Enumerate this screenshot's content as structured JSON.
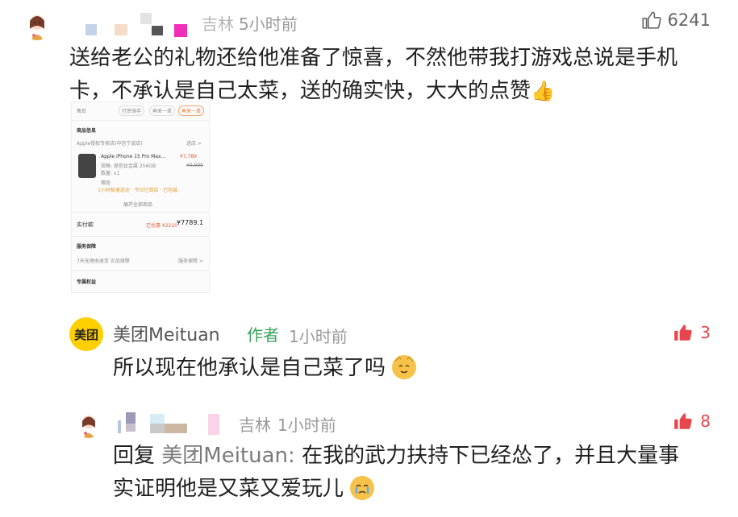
{
  "top_comment": {
    "author": "吉林",
    "time": "5小时前",
    "likes": "6241",
    "text_line1": "送给老公的礼物还给他准备了惊喜，不然他带我打游戏总说是手机",
    "text_line2": "卡，不承认是自己太菜，送的确实快，大大的点赞",
    "thumb_emoji": "👍"
  },
  "order_screenshot": {
    "tab_after_sale": "售后",
    "tab_support": "打赏骑手",
    "tab_resend": "再来一单",
    "tab_again": "再来一单",
    "section_goods": "商品信息",
    "store_name": "Apple授权专卖店(中信宁波店)",
    "store_link": "进店 >",
    "product_name": "Apple iPhone 15 Pro Max...",
    "product_spec": "规格: 原色钛金属 256GB",
    "product_qty": "数量: x1",
    "product_price": "¥7,789",
    "product_orig_price": "¥9,999",
    "gift_label": "赠品",
    "promo_text": "1小时极速送达 · 今日已到店 · 已包装",
    "expand_text": "展开全部商品",
    "paid_label": "实付款",
    "paid_note": "已优惠 ¥2210",
    "paid_amount": "¥7789.1",
    "section_service": "服务保障",
    "service_text": "7天无理由退货  正品保障",
    "service_link": "服务保障 >",
    "section_delivery": "专属权益"
  },
  "reply_meituan": {
    "author": "美团Meituan",
    "badge": "作者",
    "time": "1小时前",
    "likes": "3",
    "logo_text": "美团",
    "text": "所以现在他承认是自己菜了吗"
  },
  "reply_user": {
    "author": "吉林",
    "time": "1小时前",
    "likes": "8",
    "reply_prefix": "回复",
    "reply_target": "美团Meituan",
    "reply_colon": ":",
    "text_line1": "在我的武力扶持下已经怂了，并且大量事",
    "text_line2": "实证明他是又菜又爱玩儿"
  },
  "colors": {
    "like_red": "#e8464f",
    "author_green": "#36a35a",
    "meta_gray": "#9a9a9a",
    "meituan_yellow": "#ffd000"
  }
}
